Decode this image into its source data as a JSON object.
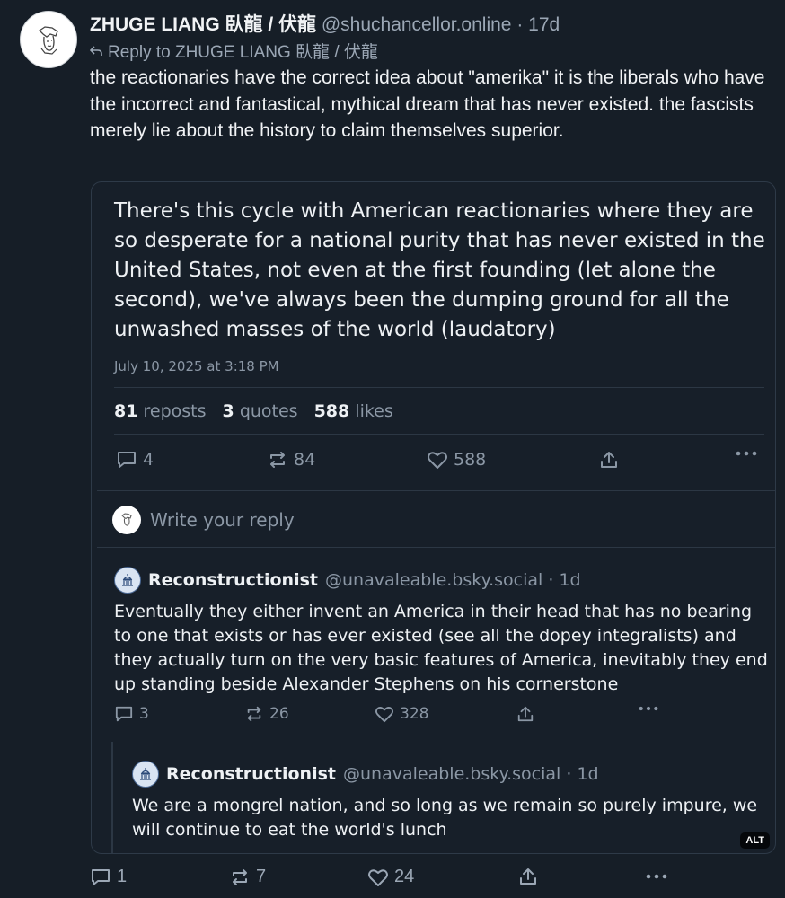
{
  "post": {
    "author": {
      "display_name": "ZHUGE LIANG 臥龍 / 伏龍",
      "handle": "@shuchancellor.online",
      "age": "· 17d"
    },
    "reply_to": "Reply to ZHUGE LIANG 臥龍 / 伏龍",
    "text": "the reactionaries have the correct idea about \"amerika\" it is the liberals who have the incorrect and fantastical, mythical dream that has never existed. the fascists merely lie about the history to claim themselves superior.",
    "actions": {
      "replies": "1",
      "reposts": "7",
      "likes": "24"
    }
  },
  "screenshot": {
    "quoted_text": "There's this cycle with American reactionaries where they are so desperate for a national purity that has never existed in the United States, not even at the first founding (let alone the second), we've always been the dumping ground for all the unwashed masses of the world (laudatory)",
    "date": "July 10, 2025 at 3:18 PM",
    "stats": {
      "reposts_count": "81",
      "reposts_label": "reposts",
      "quotes_count": "3",
      "quotes_label": "quotes",
      "likes_count": "588",
      "likes_label": "likes"
    },
    "actions": {
      "replies": "4",
      "reposts": "84",
      "likes": "588"
    },
    "reply_placeholder": "Write your reply",
    "reply1": {
      "name": "Reconstructionist",
      "handle": "@unavaleable.bsky.social · 1d",
      "text": "Eventually they either invent an America in their head that has no bearing to one that exists or has ever existed (see all the dopey integralists) and they actually turn on the very basic features of America, inevitably they end up standing beside Alexander Stephens on his cornerstone",
      "actions": {
        "replies": "3",
        "reposts": "26",
        "likes": "328"
      }
    },
    "reply2": {
      "name": "Reconstructionist",
      "handle": "@unavaleable.bsky.social · 1d",
      "text": "We are a mongrel nation, and so long as we remain so purely impure, we will continue to eat the world's lunch"
    },
    "alt_badge": "ALT"
  },
  "icons": [
    "reply-icon",
    "repost-icon",
    "like-icon",
    "share-icon",
    "more-icon",
    "reply-arrow-icon"
  ],
  "colors": {
    "background": "#161e27",
    "text": "#f1f3f5",
    "muted": "#9ba7b5",
    "border": "#2e3a48"
  }
}
